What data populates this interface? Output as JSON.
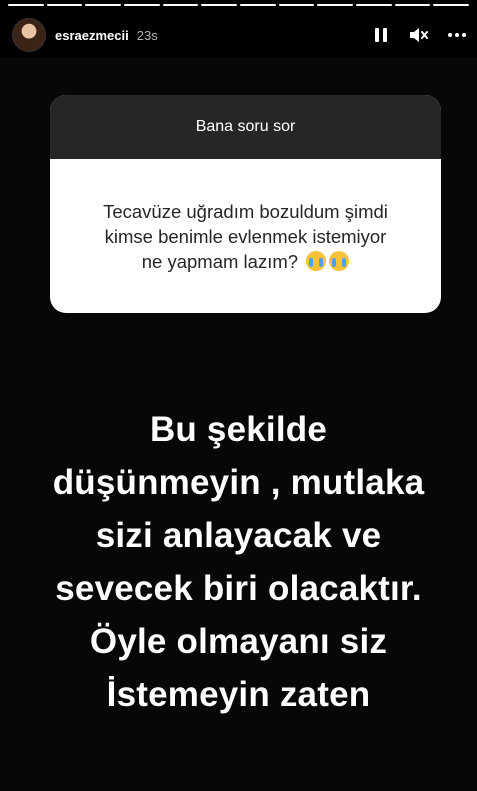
{
  "story": {
    "username": "esraezmecii",
    "time_ago": "23s",
    "progress_segments": 12,
    "current_segment": 12
  },
  "icons": {
    "pause": "pause-icon",
    "mute": "speaker-muted-icon",
    "more": "more-options-icon"
  },
  "question_card": {
    "header": "Bana soru sor",
    "question_lines": [
      "Tecavüze uğradım bozuldum şimdi",
      "kimse benimle evlenmek istemiyor",
      "ne yapmam lazım?"
    ],
    "emoji": "crying-face-emoji"
  },
  "answer": {
    "lines": [
      "Bu şekilde",
      "düşünmeyin , mutlaka",
      "sizi anlayacak ve",
      "sevecek biri olacaktır.",
      "Öyle olmayanı siz",
      "İstemeyin zaten"
    ]
  },
  "colors": {
    "background": "#000000",
    "card_header": "#262626",
    "card_body": "#ffffff",
    "text": "#ffffff"
  }
}
